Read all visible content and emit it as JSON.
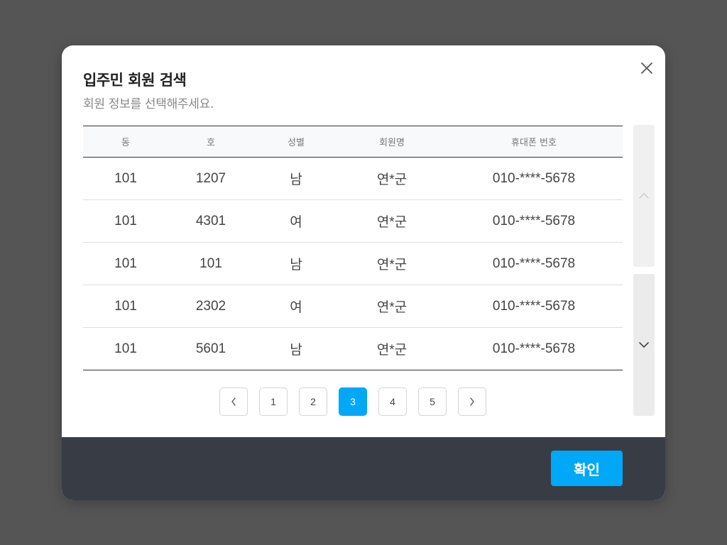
{
  "modal": {
    "title": "입주민 회원 검색",
    "subtitle": "회원 정보를 선택해주세요."
  },
  "table": {
    "headers": {
      "dong": "동",
      "ho": "호",
      "gender": "성별",
      "name": "회원명",
      "phone": "휴대폰 번호"
    },
    "rows": [
      {
        "dong": "101",
        "ho": "1207",
        "gender": "남",
        "name": "연*군",
        "phone": "010-****-5678"
      },
      {
        "dong": "101",
        "ho": "4301",
        "gender": "여",
        "name": "연*군",
        "phone": "010-****-5678"
      },
      {
        "dong": "101",
        "ho": "101",
        "gender": "남",
        "name": "연*군",
        "phone": "010-****-5678"
      },
      {
        "dong": "101",
        "ho": "2302",
        "gender": "여",
        "name": "연*군",
        "phone": "010-****-5678"
      },
      {
        "dong": "101",
        "ho": "5601",
        "gender": "남",
        "name": "연*군",
        "phone": "010-****-5678"
      }
    ]
  },
  "pagination": {
    "pages": [
      "1",
      "2",
      "3",
      "4",
      "5"
    ],
    "current_page": "3",
    "prev_icon": "chevron-left-icon",
    "next_icon": "chevron-right-icon"
  },
  "footer": {
    "confirm_label": "확인"
  },
  "colors": {
    "accent": "#00a8f7",
    "footer_bg": "#383c44",
    "overlay": "#555555"
  }
}
